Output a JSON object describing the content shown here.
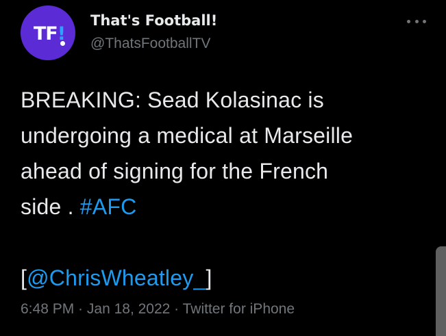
{
  "author": {
    "avatar_text": "TF",
    "avatar_bang": "!",
    "name": "That's Football!",
    "handle": "@ThatsFootballTV"
  },
  "tweet": {
    "line1": "BREAKING: Sead Kolasinac is",
    "line2": "undergoing a medical at Marseille",
    "line3": "ahead of signing for the French",
    "line4_text": "side . ",
    "hashtag": "#AFC",
    "bracket_open": "[",
    "mention": "@ChrisWheatley_",
    "bracket_close": "]"
  },
  "meta": {
    "time": "6:48 PM",
    "sep1": " · ",
    "date": "Jan 18, 2022",
    "sep2": " · ",
    "source": "Twitter for iPhone"
  },
  "icons": {
    "more": "more-horizontal-icon"
  },
  "colors": {
    "background": "#000000",
    "text": "#e7e9ea",
    "secondary": "#71767b",
    "link": "#1d9bf0",
    "avatar": "#5b2bd6"
  }
}
